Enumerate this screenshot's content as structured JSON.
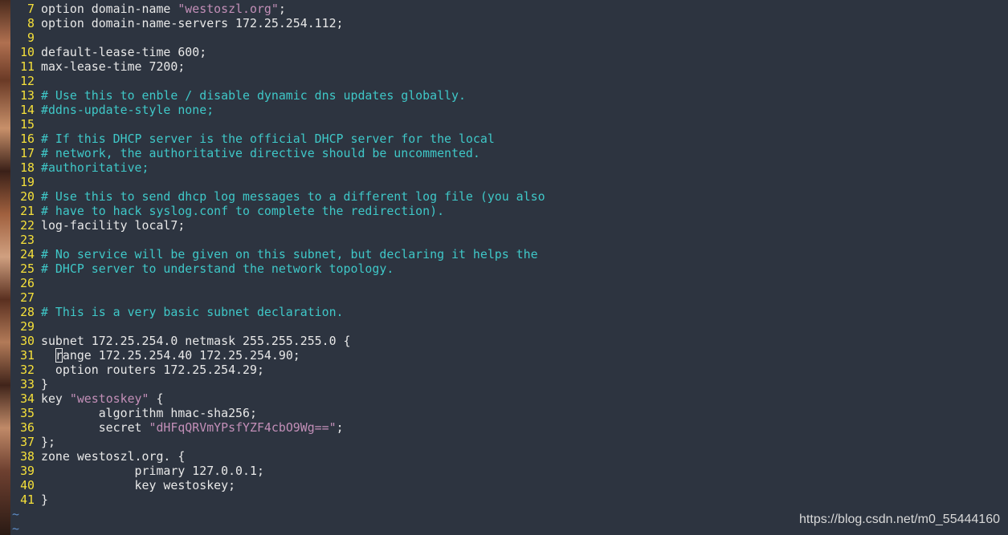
{
  "editor": {
    "lines": [
      {
        "num": "7",
        "pre": "option domain-name ",
        "str": "\"westoszl.org\"",
        "post": ";"
      },
      {
        "num": "8",
        "pre": "option domain-name-servers 172.25.254.112;"
      },
      {
        "num": "9",
        "pre": ""
      },
      {
        "num": "10",
        "pre": "default-lease-time 600;"
      },
      {
        "num": "11",
        "pre": "max-lease-time 7200;"
      },
      {
        "num": "12",
        "pre": ""
      },
      {
        "num": "13",
        "comment": true,
        "pre": "# Use this to enble / disable dynamic dns updates globally."
      },
      {
        "num": "14",
        "comment": true,
        "pre": "#ddns-update-style none;"
      },
      {
        "num": "15",
        "pre": ""
      },
      {
        "num": "16",
        "comment": true,
        "pre": "# If this DHCP server is the official DHCP server for the local"
      },
      {
        "num": "17",
        "comment": true,
        "pre": "# network, the authoritative directive should be uncommented."
      },
      {
        "num": "18",
        "comment": true,
        "pre": "#authoritative;"
      },
      {
        "num": "19",
        "pre": ""
      },
      {
        "num": "20",
        "comment": true,
        "pre": "# Use this to send dhcp log messages to a different log file (you also"
      },
      {
        "num": "21",
        "comment": true,
        "pre": "# have to hack syslog.conf to complete the redirection)."
      },
      {
        "num": "22",
        "pre": "log-facility local7;"
      },
      {
        "num": "23",
        "pre": ""
      },
      {
        "num": "24",
        "comment": true,
        "pre": "# No service will be given on this subnet, but declaring it helps the"
      },
      {
        "num": "25",
        "comment": true,
        "pre": "# DHCP server to understand the network topology."
      },
      {
        "num": "26",
        "pre": ""
      },
      {
        "num": "27",
        "pre": ""
      },
      {
        "num": "28",
        "comment": true,
        "pre": "# This is a very basic subnet declaration."
      },
      {
        "num": "29",
        "pre": ""
      },
      {
        "num": "30",
        "pre": "subnet 172.25.254.0 netmask 255.255.255.0 {"
      },
      {
        "num": "31",
        "pre": "  ",
        "cursor": "r",
        "post": "ange 172.25.254.40 172.25.254.90;"
      },
      {
        "num": "32",
        "pre": "  option routers 172.25.254.29;"
      },
      {
        "num": "33",
        "pre": "}"
      },
      {
        "num": "34",
        "pre": "key ",
        "str": "\"westoskey\"",
        "post": " {"
      },
      {
        "num": "35",
        "pre": "        algorithm hmac-sha256;"
      },
      {
        "num": "36",
        "pre": "        secret ",
        "str": "\"dHFqQRVmYPsfYZF4cbO9Wg==\"",
        "post": ";"
      },
      {
        "num": "37",
        "pre": "};"
      },
      {
        "num": "38",
        "pre": "zone westoszl.org. {"
      },
      {
        "num": "39",
        "pre": "             primary 127.0.0.1;"
      },
      {
        "num": "40",
        "pre": "             key westoskey;"
      },
      {
        "num": "41",
        "pre": "}"
      }
    ],
    "tildes": [
      "~",
      "~"
    ]
  },
  "watermark": "https://blog.csdn.net/m0_55444160",
  "colors": {
    "background": "#2d3440",
    "line_number": "#f5e03a",
    "comment": "#3fc8c8",
    "string": "#c38fb8",
    "text": "#e8e8e8",
    "tilde": "#5f8ec8"
  }
}
